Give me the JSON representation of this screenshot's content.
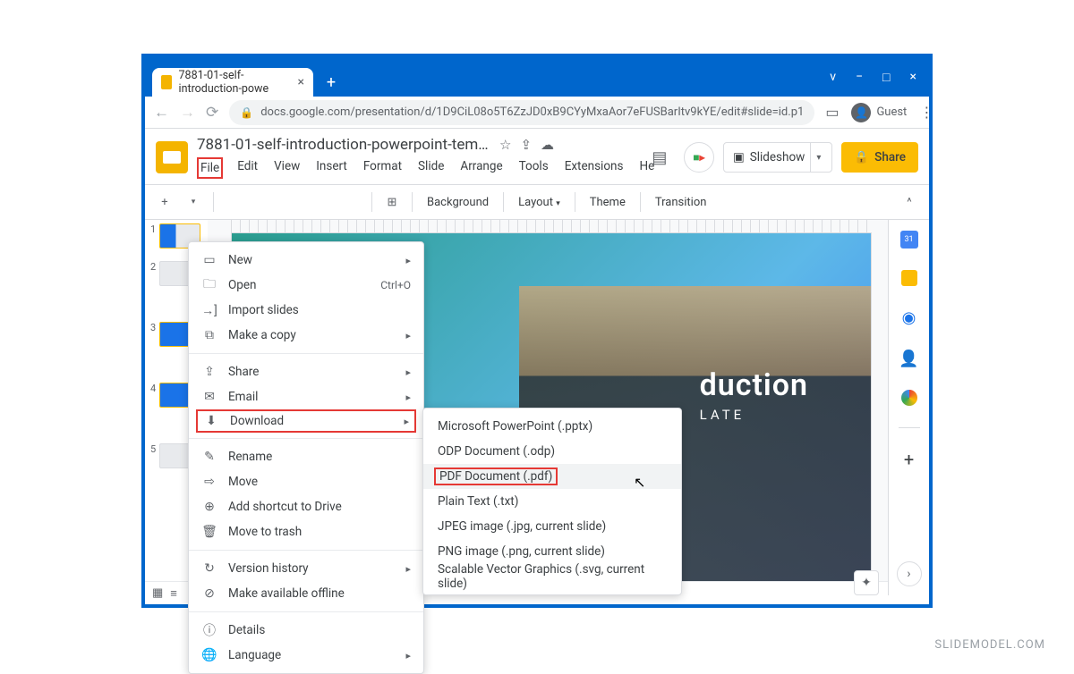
{
  "window": {
    "tab_title": "7881-01-self-introduction-powe",
    "minimize": "v",
    "restore": "−",
    "maximize": "□",
    "close": "×",
    "new_tab": "+"
  },
  "browser": {
    "back": "←",
    "forward": "→",
    "reload": "⟳",
    "lock": "🔒",
    "url": "docs.google.com/presentation/d/1D9CiL08o5T6ZzJD0xB9CYyMxaAor7eFUSBarItv9kYE/edit#slide=id.p1",
    "reader_icon": "▭",
    "guest_label": "Guest",
    "overflow": "⋮"
  },
  "app": {
    "doc_title": "7881-01-self-introduction-powerpoint-templ...",
    "star": "☆",
    "move_icon": "⇪",
    "cloud_icon": "☁",
    "comment_icon": "▤",
    "slideshow_icon": "▣",
    "slideshow_label": "Slideshow",
    "slideshow_caret": "▾",
    "share_lock": "🔒",
    "share_label": "Share"
  },
  "menubar": {
    "file": "File",
    "edit": "Edit",
    "view": "View",
    "insert": "Insert",
    "format": "Format",
    "slide": "Slide",
    "arrange": "Arrange",
    "tools": "Tools",
    "extensions": "Extensions",
    "help": "He"
  },
  "toolbar": {
    "new_slide": "+",
    "caret": "▾",
    "textbox": "⊞",
    "background": "Background",
    "layout": "Layout",
    "layout_caret": "▾",
    "theme": "Theme",
    "transition": "Transition",
    "collapse": "^"
  },
  "file_menu": {
    "new": "New",
    "open": "Open",
    "open_shortcut": "Ctrl+O",
    "import": "Import slides",
    "make_copy": "Make a copy",
    "share": "Share",
    "email": "Email",
    "download": "Download",
    "rename": "Rename",
    "move": "Move",
    "add_shortcut": "Add shortcut to Drive",
    "trash": "Move to trash",
    "version": "Version history",
    "offline": "Make available offline",
    "details": "Details",
    "language": "Language",
    "arrow": "▸"
  },
  "download_submenu": {
    "pptx": "Microsoft PowerPoint (.pptx)",
    "odp": "ODP Document (.odp)",
    "pdf": "PDF Document (.pdf)",
    "txt": "Plain Text (.txt)",
    "jpeg": "JPEG image (.jpg, current slide)",
    "png": "PNG image (.png, current slide)",
    "svg": "Scalable Vector Graphics (.svg, current slide)"
  },
  "slide_content": {
    "heading_fragment": "duction",
    "sub_fragment": "LATE"
  },
  "side_panel": {
    "calendar_day": "31"
  },
  "thumbs": {
    "n1": "1",
    "n2": "2",
    "n3": "3",
    "n4": "4",
    "n5": "5"
  },
  "footer": {
    "grid": "▦",
    "list": "≡"
  },
  "watermark": "SLIDEMODEL.COM"
}
